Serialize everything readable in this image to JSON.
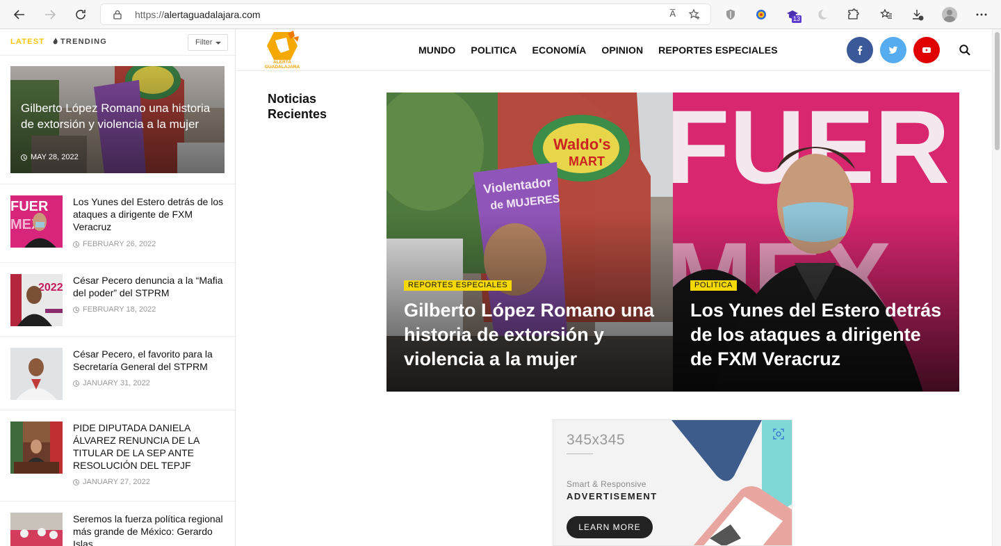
{
  "browser": {
    "url_scheme": "https://",
    "url_host": "alertaguadalajara.com",
    "reader_icon_text": "A̅",
    "extension_badge": "13"
  },
  "sidebar": {
    "tab_latest": "LATEST",
    "tab_trending": "TRENDING",
    "filter_label": "Filter",
    "hero": {
      "title": "Gilberto López Romano una historia de extorsión y violencia a la mujer",
      "date": "MAY 28, 2022"
    },
    "items": [
      {
        "title": "Los Yunes del Estero detrás de los ataques a dirigente de FXM Veracruz",
        "date": "FEBRUARY 26, 2022"
      },
      {
        "title": "César Pecero denuncia a la “Mafia del poder” del STPRM",
        "date": "FEBRUARY 18, 2022"
      },
      {
        "title": "César Pecero, el favorito para la Secretaría General del STPRM",
        "date": "JANUARY 31, 2022"
      },
      {
        "title": "PIDE DIPUTADA DANIELA ÁLVAREZ RENUNCIA DE LA TITULAR DE LA SEP ANTE RESOLUCIÓN DEL TEPJF",
        "date": "JANUARY 27, 2022"
      },
      {
        "title": "Seremos la fuerza política regional más grande de México: Gerardo Islas",
        "date": ""
      }
    ]
  },
  "header": {
    "logo_line1": "ALERTA",
    "logo_line2": "GUADALAJARA",
    "nav": [
      "MUNDO",
      "POLITICA",
      "ECONOMÍA",
      "OPINION",
      "REPORTES ESPECIALES"
    ],
    "social": {
      "facebook": "#3b5998",
      "twitter": "#55acee",
      "youtube": "#e00000"
    }
  },
  "main": {
    "section_title": "Noticias Recientes",
    "features": [
      {
        "category": "REPORTES ESPECIALES",
        "title": "Gilberto López Romano una historia de extorsión y violencia a la mujer"
      },
      {
        "category": "POLITICA",
        "title": "Los Yunes del Estero detrás de los ataques a dirigente de FXM Veracruz"
      }
    ],
    "ad": {
      "size": "345x345",
      "subtitle": "Smart & Responsive",
      "headline": "ADVERTISEMENT",
      "button": "LEARN MORE"
    }
  },
  "colors": {
    "accent": "#f5d800",
    "latest": "#f5c500",
    "logo": "#f5a000"
  }
}
